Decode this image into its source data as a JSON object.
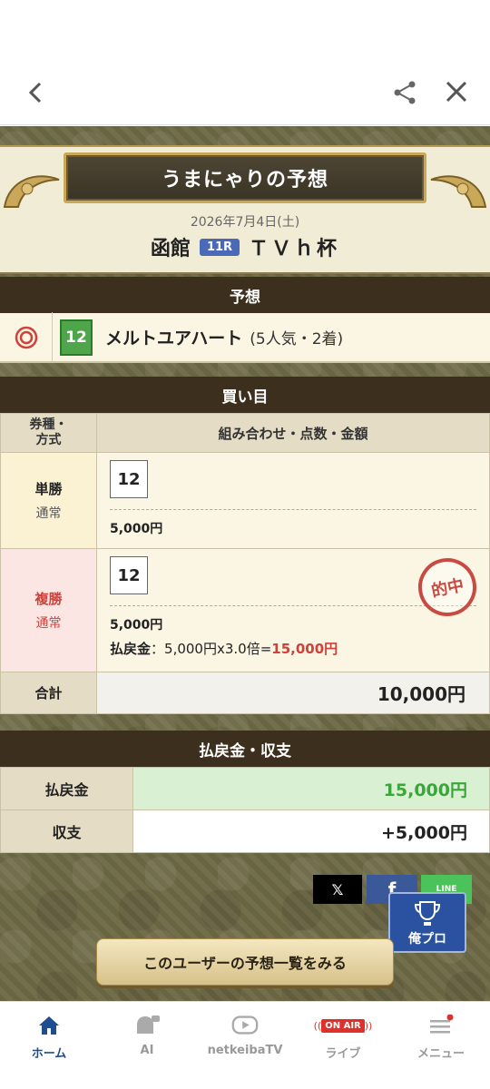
{
  "header": {
    "title": "うまにゃりの予想",
    "date": "2026年7月4日(土)",
    "venue": "函館",
    "race_no": "11R",
    "race_name": "ＴＶｈ杯"
  },
  "prediction": {
    "section_title": "予想",
    "mark": "◎",
    "horse_number": "12",
    "horse_name": "メルトユアハート",
    "popularity_result": "(5人気・2着)"
  },
  "bets": {
    "section_title": "買い目",
    "col_type": "券種・方式",
    "col_combo": "組み合わせ・点数・金額",
    "rows": [
      {
        "type": "単勝",
        "method": "通常",
        "number": "12",
        "amount": "5,000円"
      },
      {
        "type": "複勝",
        "method": "通常",
        "number": "12",
        "amount": "5,000円",
        "stamp": "的中",
        "payout_label": "払戻金",
        "payout_calc": "5,000円x3.0倍=",
        "payout_value": "15,000円"
      }
    ],
    "total_label": "合計",
    "total_value": "10,000円"
  },
  "summary": {
    "section_title": "払戻金・収支",
    "payout_label": "払戻金",
    "payout_value": "15,000円",
    "balance_label": "収支",
    "balance_value": "+5,000円"
  },
  "social": {
    "x": "𝕏",
    "facebook": "f",
    "line": "LINE"
  },
  "orepro_label": "俺プロ",
  "list_button": "このユーザーの予想一覧をみる",
  "nav": [
    {
      "label": "ホーム"
    },
    {
      "label": "AI"
    },
    {
      "label": "netkeibaTV"
    },
    {
      "label": "ライブ",
      "badge": "ON AIR"
    },
    {
      "label": "メニュー"
    }
  ],
  "colors": {
    "accent": "#1d4e8f",
    "hit": "#d0413a",
    "win": "#3aa53a"
  }
}
